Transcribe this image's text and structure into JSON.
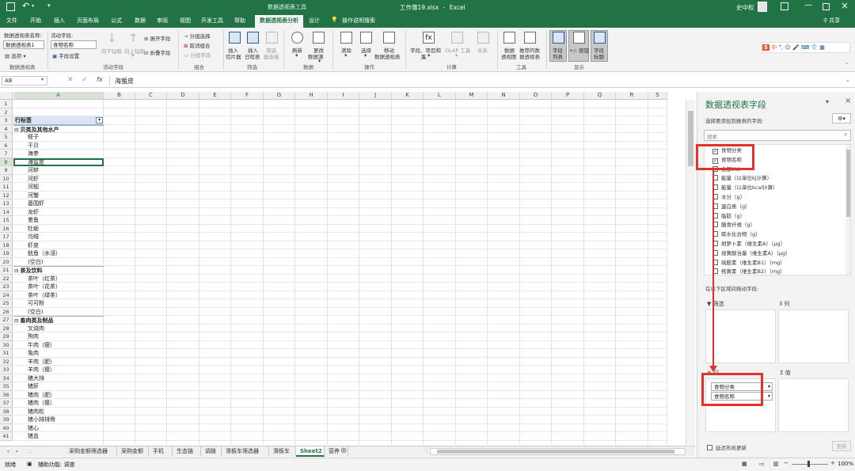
{
  "titlebar": {
    "context_tools": "数据透视表工具",
    "filename": "工作簿19.xlsx",
    "sep": "-",
    "app": "Excel",
    "user": "史中权",
    "qat_dropdown": "▾"
  },
  "tabs": [
    "文件",
    "开始",
    "插入",
    "页面布局",
    "公式",
    "数据",
    "审阅",
    "视图",
    "开发工具",
    "帮助",
    "数据透视表分析",
    "设计"
  ],
  "tell_me": "操作说明搜索",
  "share": "共享",
  "ribbon": {
    "pivot_name_label": "数据透视表名称:",
    "pivot_name_value": "数据透视表1",
    "options": "选项",
    "options_dd": "▾",
    "group_pivot": "数据透视表",
    "active_field_label": "活动字段:",
    "active_field_value": "食物名称",
    "field_settings": "字段设置",
    "drill_down": "向下钻取",
    "drill_up": "向上钻取",
    "drill_up_dd": "▾",
    "expand_field": "展开字段",
    "collapse_field": "折叠字段",
    "group_active_field": "活动字段",
    "group_selection": "分组选择",
    "ungroup": "取消组合",
    "group_field": "分组字段",
    "group_group": "组合",
    "insert_slicer_1": "插入",
    "insert_slicer_2": "切片器",
    "insert_timeline_1": "插入",
    "insert_timeline_2": "日程表",
    "filter_conn_1": "筛选",
    "filter_conn_2": "器连接",
    "group_filter": "筛选",
    "refresh": "刷新",
    "refresh_dd": "▾",
    "change_source_1": "更改",
    "change_source_2": "数据源",
    "change_source_dd": "▾",
    "group_data": "数据",
    "clear": "清除",
    "clear_dd": "▾",
    "select": "选择",
    "select_dd": "▾",
    "move_1": "移动",
    "move_2": "数据透视表",
    "group_actions": "操作",
    "fields_items_1": "字段、项目和",
    "fields_items_2": "集",
    "fields_items_dd": "▾",
    "olap_tools": "OLAP 工具",
    "olap_dd": "▾",
    "relationships": "关系",
    "group_calc": "计算",
    "pivot_chart_1": "数据",
    "pivot_chart_2": "透视图",
    "recommended_1": "推荐的数",
    "recommended_2": "据透视表",
    "group_tools": "工具",
    "field_list_1": "字段",
    "field_list_2": "列表",
    "buttons_1": "+/- 按钮",
    "field_headers_1": "字段",
    "field_headers_2": "标题",
    "group_show": "显示"
  },
  "ime": [
    "S",
    "中",
    "°,",
    "☺",
    "🎤",
    "⌨",
    "👕",
    "▦"
  ],
  "formula": {
    "name_box": "A8",
    "fx": "fx",
    "value": "海蜇皮"
  },
  "columns": [
    "A",
    "B",
    "C",
    "D",
    "E",
    "F",
    "G",
    "H",
    "I",
    "J",
    "K",
    "L",
    "M",
    "N",
    "O",
    "P",
    "Q",
    "R",
    "S"
  ],
  "rows": [
    {
      "n": "1",
      "text": "",
      "type": "empty"
    },
    {
      "n": "2",
      "text": "",
      "type": "empty"
    },
    {
      "n": "3",
      "text": "行标签",
      "type": "header"
    },
    {
      "n": "4",
      "text": "贝类及其他水产",
      "type": "group"
    },
    {
      "n": "5",
      "text": "蛏子",
      "type": "item"
    },
    {
      "n": "6",
      "text": "干贝",
      "type": "item"
    },
    {
      "n": "7",
      "text": "海参",
      "type": "item"
    },
    {
      "n": "8",
      "text": "海蜇皮",
      "type": "selected"
    },
    {
      "n": "9",
      "text": "河蚌",
      "type": "item"
    },
    {
      "n": "10",
      "text": "河虾",
      "type": "item"
    },
    {
      "n": "11",
      "text": "河蚬",
      "type": "item"
    },
    {
      "n": "12",
      "text": "河蟹",
      "type": "item"
    },
    {
      "n": "13",
      "text": "基围虾",
      "type": "item"
    },
    {
      "n": "14",
      "text": "龙虾",
      "type": "item"
    },
    {
      "n": "15",
      "text": "墨鱼",
      "type": "item"
    },
    {
      "n": "16",
      "text": "牡蛎",
      "type": "item"
    },
    {
      "n": "17",
      "text": "乌贼",
      "type": "item"
    },
    {
      "n": "18",
      "text": "虾皮",
      "type": "item"
    },
    {
      "n": "19",
      "text": "鱿鱼（水浸）",
      "type": "item"
    },
    {
      "n": "20",
      "text": "(空白)",
      "type": "item"
    },
    {
      "n": "21",
      "text": "茶及饮料",
      "type": "group"
    },
    {
      "n": "22",
      "text": "茶叶（红茶）",
      "type": "item"
    },
    {
      "n": "23",
      "text": "茶叶（花茶）",
      "type": "item"
    },
    {
      "n": "24",
      "text": "茶叶（绿茶）",
      "type": "item"
    },
    {
      "n": "25",
      "text": "可可粉",
      "type": "item"
    },
    {
      "n": "26",
      "text": "(空白)",
      "type": "item"
    },
    {
      "n": "27",
      "text": "畜肉类及制品",
      "type": "group"
    },
    {
      "n": "28",
      "text": "叉烧肉",
      "type": "item"
    },
    {
      "n": "29",
      "text": "狗肉",
      "type": "item"
    },
    {
      "n": "30",
      "text": "牛肉（瘦）",
      "type": "item"
    },
    {
      "n": "31",
      "text": "兔肉",
      "type": "item"
    },
    {
      "n": "32",
      "text": "羊肉（肥）",
      "type": "item"
    },
    {
      "n": "33",
      "text": "羊肉（瘦）",
      "type": "item"
    },
    {
      "n": "34",
      "text": "猪大排",
      "type": "item"
    },
    {
      "n": "35",
      "text": "猪肝",
      "type": "item"
    },
    {
      "n": "36",
      "text": "猪肉（肥）",
      "type": "item"
    },
    {
      "n": "37",
      "text": "猪肉（瘦）",
      "type": "item"
    },
    {
      "n": "38",
      "text": "猪肉松",
      "type": "item"
    },
    {
      "n": "39",
      "text": "猪小排排骨",
      "type": "item"
    },
    {
      "n": "40",
      "text": "猪心",
      "type": "item"
    },
    {
      "n": "41",
      "text": "猪血",
      "type": "item"
    }
  ],
  "sheets": [
    "采购金额筛选器",
    "采购金额",
    "手机",
    "生态链",
    "调拨",
    "滑板车筛选器",
    "滑板车",
    "Sheet2",
    "营养"
  ],
  "active_sheet": "Sheet2",
  "status": {
    "ready": "就绪",
    "accessibility": "辅助功能: 调查",
    "zoom": "100%"
  },
  "pane": {
    "title": "数据透视表字段",
    "subtitle": "选择要添加到报表的字段:",
    "search_placeholder": "搜索",
    "fields": [
      {
        "label": "食物分类",
        "checked": true
      },
      {
        "label": "食物名称",
        "checked": true
      },
      {
        "label": "食部(%)",
        "checked": false
      },
      {
        "label": "能量（以单位kj计算）",
        "checked": false
      },
      {
        "label": "能量（以单位kcal计算）",
        "checked": false
      },
      {
        "label": "水分（g）",
        "checked": false
      },
      {
        "label": "蛋白质（g）",
        "checked": false
      },
      {
        "label": "脂肪（g）",
        "checked": false
      },
      {
        "label": "膳食纤维（g）",
        "checked": false
      },
      {
        "label": "碳水化合物（g）",
        "checked": false
      },
      {
        "label": "胡萝卜素（维生素A）（μg）",
        "checked": false
      },
      {
        "label": "视黄醇当量（维生素A）（μg）",
        "checked": false
      },
      {
        "label": "硫胺素（维生素B1）（mg）",
        "checked": false
      },
      {
        "label": "核黄素（维生素B2）（mg）",
        "checked": false
      }
    ],
    "drag_prompt": "在以下区域间拖动字段:",
    "area_filter": "筛选",
    "area_columns": "列",
    "area_rows": "行",
    "area_values": "值",
    "row_chips": [
      "食物分类",
      "食物名称"
    ],
    "defer_update": "延迟布局更新",
    "update_button": "更新"
  },
  "colors": {
    "excel_green": "#217346",
    "highlight_red": "#e0332d",
    "pivot_blue": "#dbe5f1"
  }
}
